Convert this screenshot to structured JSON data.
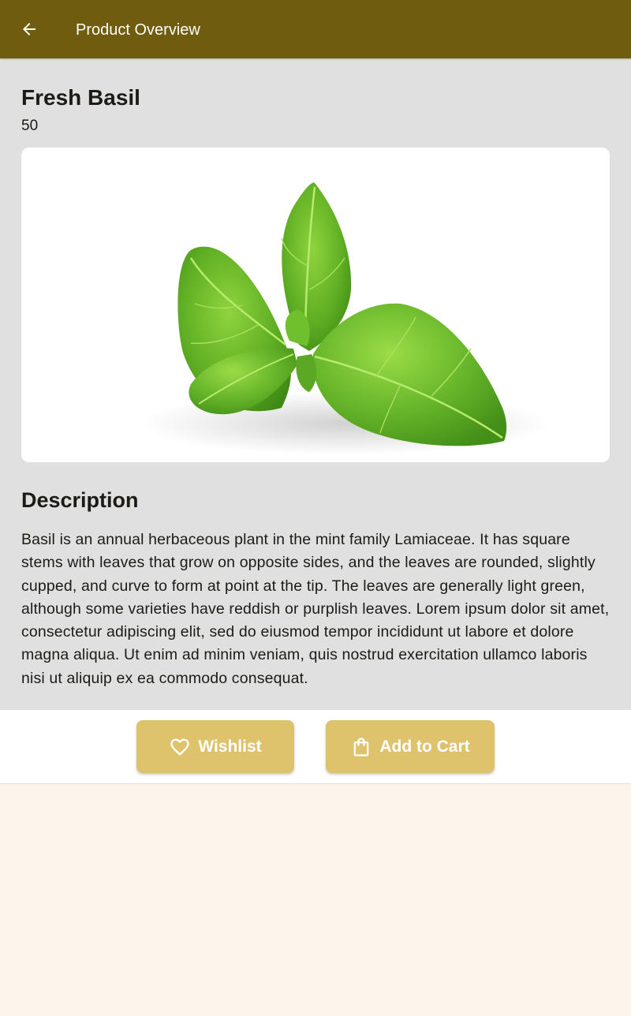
{
  "appbar": {
    "title": "Product Overview",
    "back_icon": "arrow-back-icon",
    "background": "#6f5c0e"
  },
  "product": {
    "name": "Fresh Basil",
    "price": "50",
    "image_subject": "basil-leaves"
  },
  "description": {
    "heading": "Description",
    "text": "Basil is an annual herbaceous plant in the mint family Lamiaceae. It has square stems with leaves that grow on opposite sides, and the leaves are rounded, slightly cupped, and curve to form at point at the tip. The leaves are generally light green, although some varieties have reddish or purplish leaves. Lorem ipsum dolor sit amet, consectetur adipiscing elit, sed do eiusmod tempor incididunt ut labore et dolore magna aliqua. Ut enim ad minim veniam, quis nostrud exercitation ullamco laboris nisi ut aliquip ex ea commodo consequat."
  },
  "actions": {
    "wishlist_label": "Wishlist",
    "wishlist_icon": "heart-outline-icon",
    "cart_label": "Add to Cart",
    "cart_icon": "shopping-bag-icon",
    "button_color": "#dfc36c"
  },
  "colors": {
    "content_background": "#e0e0e0",
    "page_background": "#fdf5eb"
  }
}
